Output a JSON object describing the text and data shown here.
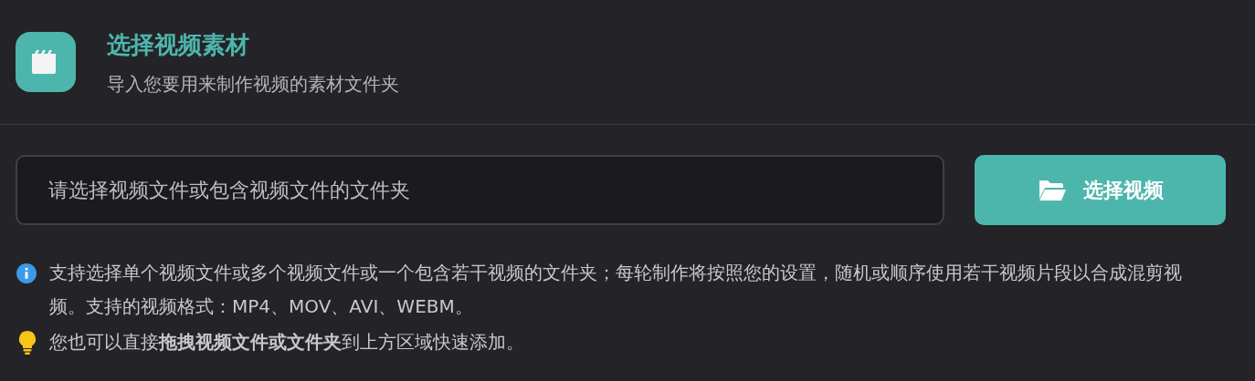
{
  "header": {
    "title": "选择视频素材",
    "subtitle": "导入您要用来制作视频的素材文件夹"
  },
  "source_field": {
    "placeholder": "请选择视频文件或包含视频文件的文件夹"
  },
  "select_button": {
    "label": "选择视频"
  },
  "notes": [
    {
      "kind": "info",
      "text": "支持选择单个视频文件或多个视频文件或一个包含若干视频的文件夹；每轮制作将按照您的设置，随机或顺序使用若干视频片段以合成混剪视频。支持的视频格式：MP4、MOV、AVI、WEBM。"
    },
    {
      "kind": "tip",
      "text": "您也可以直接**拖拽视频文件或文件夹**到上方区域快速添加。"
    }
  ]
}
